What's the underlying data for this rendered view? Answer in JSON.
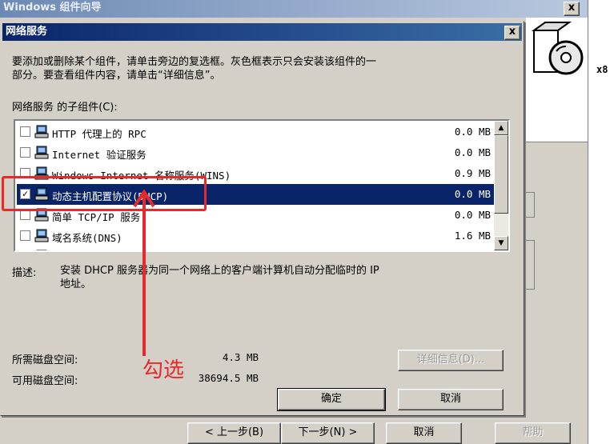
{
  "wizard": {
    "title": "Windows 组件向导",
    "close_symbol": "x",
    "side_text": "x8",
    "buttons": {
      "back": "< 上一步(B)",
      "next": "下一步(N) >",
      "cancel": "取消",
      "help": "帮助"
    }
  },
  "dialog": {
    "title": "网络服务",
    "close_symbol": "x",
    "instruction_line1": "要添加或删除某个组件，请单击旁边的复选框。灰色框表示只会安装该组件的一",
    "instruction_line2": "部分。要查看组件内容，请单击“详细信息”。",
    "subcomponents_label": "网络服务 的子组件(C):",
    "components": [
      {
        "label": "HTTP 代理上的 RPC",
        "size": "0.0 MB",
        "checked": false,
        "selected": false
      },
      {
        "label": "Internet 验证服务",
        "size": "0.0 MB",
        "checked": false,
        "selected": false
      },
      {
        "label": "Windows Internet 名称服务(WINS)",
        "size": "0.9 MB",
        "checked": false,
        "selected": false
      },
      {
        "label": "动态主机配置协议(DHCP)",
        "size": "0.0 MB",
        "checked": true,
        "selected": true
      },
      {
        "label": "简单 TCP/IP 服务",
        "size": "0.0 MB",
        "checked": false,
        "selected": false
      },
      {
        "label": "域名系统(DNS)",
        "size": "1.6 MB",
        "checked": false,
        "selected": false
      },
      {
        "label": "远程访问隔离服务",
        "size": "",
        "checked": false,
        "selected": false
      }
    ],
    "description_label": "描述:",
    "description_line1": "安装 DHCP 服务器为同一个网络上的客户端计算机自动分配临时的 IP",
    "description_line2": "地址。",
    "disk_required_label": "所需磁盘空间:",
    "disk_required_value": "4.3 MB",
    "disk_available_label": "可用磁盘空间:",
    "disk_available_value": "38694.5 MB",
    "details_button": "详细信息(D)...",
    "ok_button": "确定",
    "cancel_button": "取消"
  },
  "annotation": {
    "text": "勾选",
    "color": "#e8292a"
  }
}
